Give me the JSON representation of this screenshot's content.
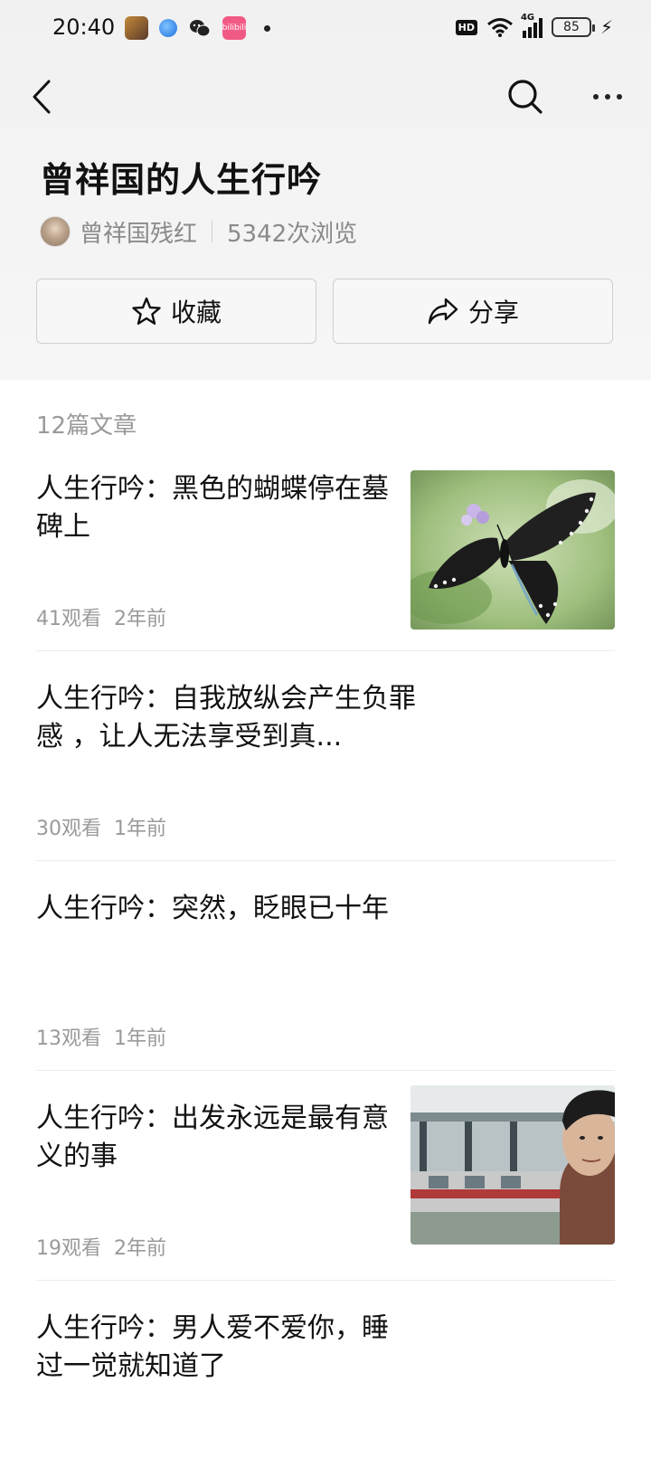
{
  "status_bar": {
    "time": "20:40",
    "app_pink_label": "bilibili",
    "network": "4G",
    "battery": "85"
  },
  "nav": {
    "back_icon": "chevron-left-icon",
    "search_icon": "search-icon",
    "more_icon": "more-dots-icon"
  },
  "collection": {
    "title": "曾祥国的人生行吟",
    "author": "曾祥国残红",
    "views": "5342次浏览",
    "favorite_label": "收藏",
    "share_label": "分享",
    "article_count": "12篇文章"
  },
  "articles": [
    {
      "title": "人生行吟：黑色的蝴蝶停在墓碑上",
      "views": "41观看",
      "time": "2年前",
      "has_thumb": true
    },
    {
      "title": "人生行吟：自我放纵会产生负罪感 ，让人无法享受到真...",
      "views": "30观看",
      "time": "1年前",
      "has_thumb": false
    },
    {
      "title": "人生行吟：突然，眨眼已十年",
      "views": "13观看",
      "time": "1年前",
      "has_thumb": false
    },
    {
      "title": "人生行吟：出发永远是最有意义的事",
      "views": "19观看",
      "time": "2年前",
      "has_thumb": true
    },
    {
      "title": "人生行吟：男人爱不爱你，睡过一觉就知道了",
      "views": "",
      "time": "",
      "has_thumb": false
    }
  ],
  "colors": {
    "text_primary": "#111111",
    "text_secondary": "#8a8a8a",
    "text_meta": "#9a9a9a",
    "divider": "#ececec",
    "button_border": "#cfcfcf"
  }
}
